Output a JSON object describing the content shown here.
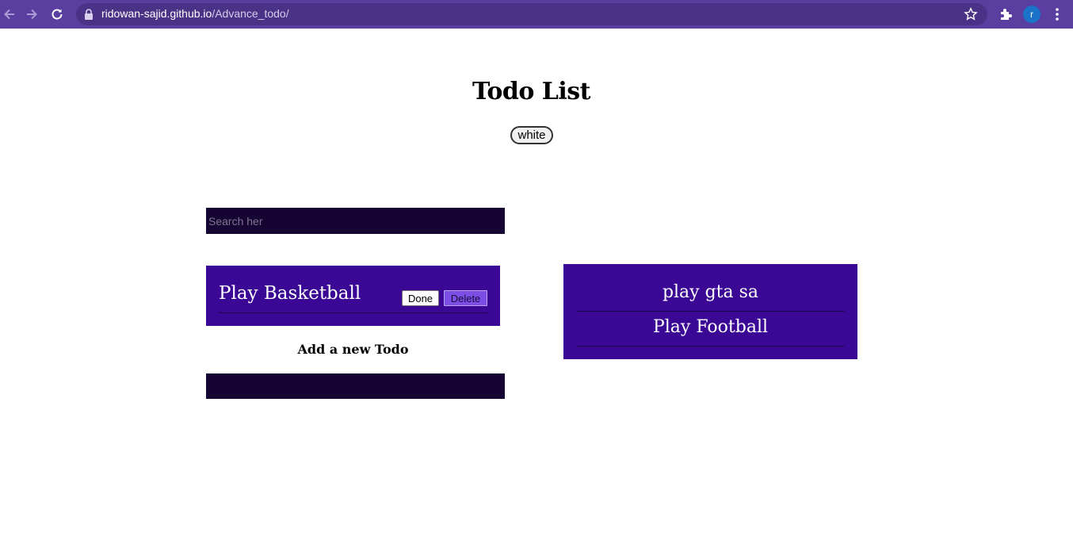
{
  "browser": {
    "url_host": "ridowan-sajid.github.io",
    "url_path": "/Advance_todo/",
    "profile_initial": "r",
    "icons": [
      "back-icon",
      "forward-icon",
      "reload-icon",
      "lock-icon",
      "star-icon",
      "extensions-icon",
      "menu-icon"
    ]
  },
  "page": {
    "title": "Todo List",
    "theme_toggle_label": "white",
    "search_placeholder": "Search her",
    "add_heading": "Add a new Todo",
    "add_input_value": ""
  },
  "pending_todos": [
    {
      "text": "Play Basketball",
      "done_label": "Done",
      "delete_label": "Delete"
    }
  ],
  "completed_todos": [
    {
      "text": "play gta sa"
    },
    {
      "text": "Play Football"
    }
  ],
  "colors": {
    "chrome": "#5a3ea0",
    "panel": "#3a0895",
    "input_bg": "#160433",
    "delete_button": "#7d4ee6"
  }
}
